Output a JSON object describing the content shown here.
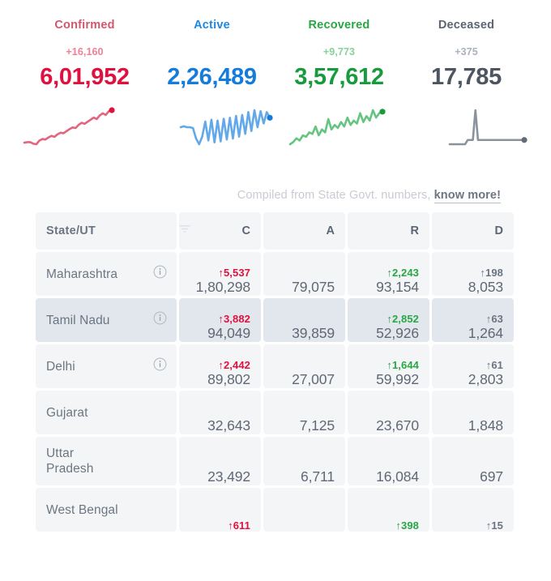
{
  "summary": {
    "stats": [
      {
        "label": "Confirmed",
        "delta": "+16,160",
        "value": "6,01,952",
        "label_color": "#d4566e",
        "delta_color": "#f08096",
        "value_color": "#e0113f",
        "line_color": "#e5637d",
        "dot_color": "#e0113f"
      },
      {
        "label": "Active",
        "delta": "",
        "value": "2,26,489",
        "label_color": "#1d87e4",
        "delta_color": "#7db9ef",
        "value_color": "#157cdb",
        "line_color": "#63a8e8",
        "dot_color": "#157cdb"
      },
      {
        "label": "Recovered",
        "delta": "+9,773",
        "value": "3,57,612",
        "label_color": "#28a745",
        "delta_color": "#86d399",
        "value_color": "#179b3d",
        "line_color": "#66c481",
        "dot_color": "#179b3d"
      },
      {
        "label": "Deceased",
        "delta": "+375",
        "value": "17,785",
        "label_color": "#5c6672",
        "delta_color": "#aab2bc",
        "value_color": "#4d5560",
        "line_color": "#8a929c",
        "dot_color": "#636b76"
      }
    ]
  },
  "note": {
    "text": "Compiled from State Govt. numbers,",
    "link": "know more!"
  },
  "table": {
    "header": {
      "state_label": "State/UT",
      "columns": [
        "C",
        "A",
        "R",
        "D"
      ],
      "filter_icon": "filter-icon"
    },
    "rows": [
      {
        "state": "Maharashtra",
        "info": true,
        "alt": false,
        "twoline": false,
        "cells": [
          {
            "delta": "↑5,537",
            "delta_color": "#e0113f",
            "value": "1,80,298"
          },
          {
            "delta": "",
            "delta_color": "",
            "value": "79,075"
          },
          {
            "delta": "↑2,243",
            "delta_color": "#28a745",
            "value": "93,154"
          },
          {
            "delta": "↑198",
            "delta_color": "#6b7582",
            "value": "8,053"
          }
        ]
      },
      {
        "state": "Tamil Nadu",
        "info": true,
        "alt": true,
        "twoline": false,
        "cells": [
          {
            "delta": "↑3,882",
            "delta_color": "#e0113f",
            "value": "94,049"
          },
          {
            "delta": "",
            "delta_color": "",
            "value": "39,859"
          },
          {
            "delta": "↑2,852",
            "delta_color": "#28a745",
            "value": "52,926"
          },
          {
            "delta": "↑63",
            "delta_color": "#6b7582",
            "value": "1,264"
          }
        ]
      },
      {
        "state": "Delhi",
        "info": true,
        "alt": false,
        "twoline": false,
        "cells": [
          {
            "delta": "↑2,442",
            "delta_color": "#e0113f",
            "value": "89,802"
          },
          {
            "delta": "",
            "delta_color": "",
            "value": "27,007"
          },
          {
            "delta": "↑1,644",
            "delta_color": "#28a745",
            "value": "59,992"
          },
          {
            "delta": "↑61",
            "delta_color": "#6b7582",
            "value": "2,803"
          }
        ]
      },
      {
        "state": "Gujarat",
        "info": false,
        "alt": false,
        "twoline": false,
        "cells": [
          {
            "delta": "",
            "delta_color": "",
            "value": "32,643"
          },
          {
            "delta": "",
            "delta_color": "",
            "value": "7,125"
          },
          {
            "delta": "",
            "delta_color": "",
            "value": "23,670"
          },
          {
            "delta": "",
            "delta_color": "",
            "value": "1,848"
          }
        ]
      },
      {
        "state": "Uttar Pradesh",
        "info": false,
        "alt": false,
        "twoline": true,
        "cells": [
          {
            "delta": "",
            "delta_color": "",
            "value": "23,492"
          },
          {
            "delta": "",
            "delta_color": "",
            "value": "6,711"
          },
          {
            "delta": "",
            "delta_color": "",
            "value": "16,084"
          },
          {
            "delta": "",
            "delta_color": "",
            "value": "697"
          }
        ]
      },
      {
        "state": "West Bengal",
        "info": false,
        "alt": false,
        "twoline": false,
        "cells": [
          {
            "delta": "↑611",
            "delta_color": "#e0113f",
            "value": ""
          },
          {
            "delta": "",
            "delta_color": "",
            "value": ""
          },
          {
            "delta": "↑398",
            "delta_color": "#28a745",
            "value": ""
          },
          {
            "delta": "↑15",
            "delta_color": "#6b7582",
            "value": ""
          }
        ]
      }
    ]
  },
  "chart_data": {
    "type": "line",
    "title": "Daily trend sparklines",
    "series": [
      {
        "name": "Confirmed",
        "color": "#e5637d",
        "values": [
          18,
          19,
          19,
          16,
          15,
          22,
          25,
          24,
          28,
          31,
          29,
          34,
          37,
          36,
          40,
          44,
          47,
          46,
          52,
          56,
          54,
          58,
          62,
          66,
          63,
          70,
          74,
          71,
          78,
          80
        ]
      },
      {
        "name": "Active",
        "color": "#63a8e8",
        "values": [
          40,
          41,
          40,
          40,
          39,
          28,
          22,
          30,
          46,
          26,
          48,
          24,
          47,
          25,
          49,
          27,
          50,
          28,
          52,
          30,
          53,
          33,
          56,
          36,
          58,
          40,
          57,
          44,
          56,
          50
        ]
      },
      {
        "name": "Recovered",
        "color": "#66c481",
        "values": [
          14,
          17,
          22,
          19,
          26,
          24,
          30,
          28,
          38,
          26,
          34,
          30,
          48,
          34,
          40,
          36,
          44,
          38,
          50,
          40,
          46,
          42,
          56,
          44,
          52,
          46,
          60,
          50,
          56,
          58
        ]
      },
      {
        "name": "Deceased",
        "color": "#8a929c",
        "values": [
          30,
          30,
          30,
          30,
          30,
          30,
          30,
          31,
          31,
          31,
          38,
          31,
          31,
          31,
          31,
          31,
          31,
          31,
          31,
          31,
          31,
          31,
          31,
          31,
          31,
          31,
          31,
          31,
          31,
          31
        ]
      }
    ],
    "ylabel": "",
    "xlabel": "",
    "grid": false,
    "legend": "none"
  }
}
